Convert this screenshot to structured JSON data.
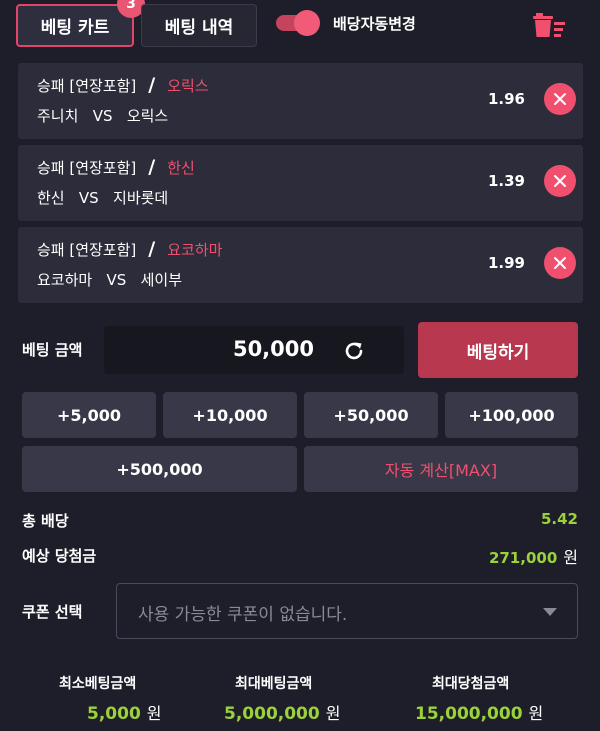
{
  "header": {
    "cart_tab": "베팅 카트",
    "cart_count": "3",
    "history_tab": "베팅 내역",
    "auto_odds_label": "배당자동변경",
    "auto_odds_on": true,
    "trash_icon": "trash-icon"
  },
  "bets": [
    {
      "market": "승패 [연장포함]",
      "pick": "오릭스",
      "home": "주니치",
      "vs": "VS",
      "away": "오릭스",
      "odds": "1.96"
    },
    {
      "market": "승패 [연장포함]",
      "pick": "한신",
      "home": "한신",
      "vs": "VS",
      "away": "지바롯데",
      "odds": "1.39"
    },
    {
      "market": "승패 [연장포함]",
      "pick": "요코하마",
      "home": "요코하마",
      "vs": "VS",
      "away": "세이부",
      "odds": "1.99"
    }
  ],
  "bet_amount": {
    "label": "베팅 금액",
    "value": "50,000",
    "submit": "베팅하기"
  },
  "quick_add": [
    "+5,000",
    "+10,000",
    "+50,000",
    "+100,000",
    "+500,000"
  ],
  "auto_calc": "자동 계산[MAX]",
  "summary": {
    "total_odds_label": "총 배당",
    "total_odds": "5.42",
    "expected_win_label": "예상 당첨금",
    "expected_win": "271,000",
    "currency": "원"
  },
  "coupon": {
    "label": "쿠폰 선택",
    "placeholder": "사용 가능한 쿠폰이 없습니다."
  },
  "limits": {
    "min_bet_label": "최소베팅금액",
    "min_bet": "5,000",
    "max_bet_label": "최대베팅금액",
    "max_bet": "5,000,000",
    "max_win_label": "최대당첨금액",
    "max_win": "15,000,000",
    "currency": "원"
  },
  "colors": {
    "accent": "#f0506e",
    "button": "#b8384f",
    "positive": "#9bd23a",
    "background": "#1e1e2a"
  }
}
